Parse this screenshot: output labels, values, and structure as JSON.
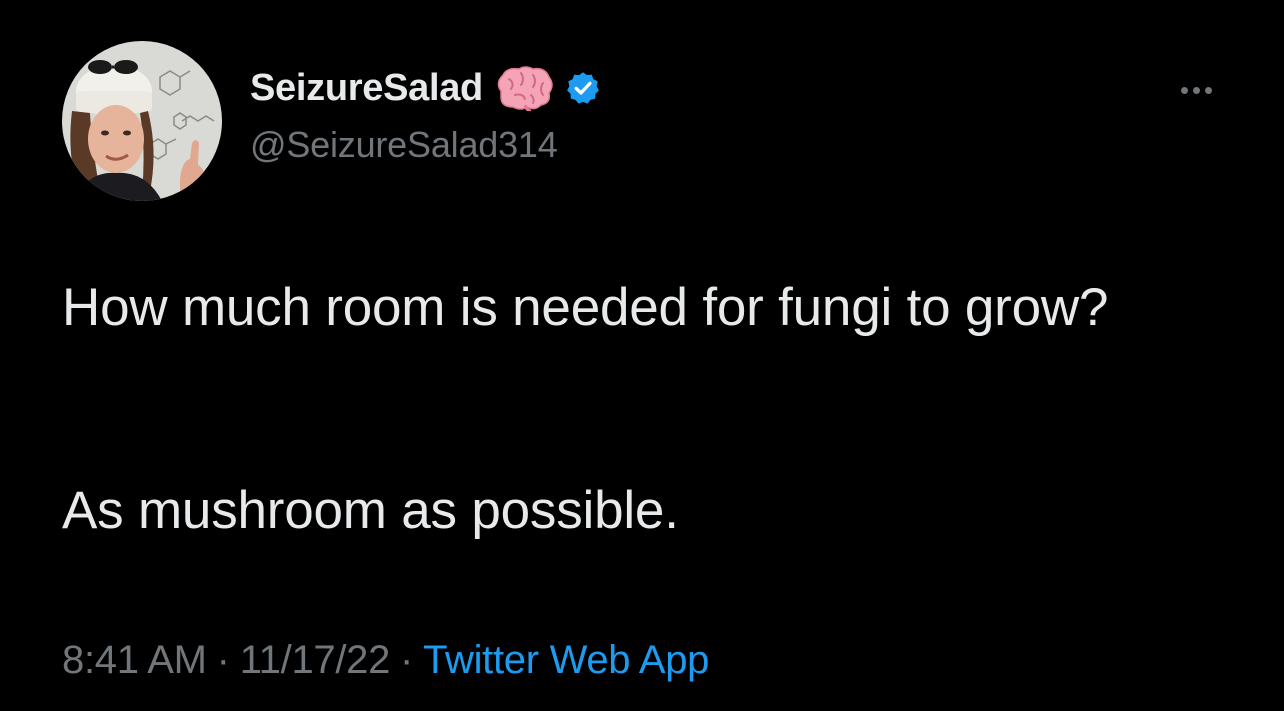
{
  "tweet": {
    "author": {
      "display_name": "SeizureSalad",
      "handle": "@SeizureSalad314",
      "name_emoji": "brain-icon",
      "verified_icon": "verified-badge-icon",
      "avatar": "profile-photo"
    },
    "more_icon": "more-options-icon",
    "text": {
      "paragraph_1": "How much room is needed for fungi to grow?",
      "paragraph_2": "As mushroom as possible."
    },
    "meta": {
      "time": "8:41 AM",
      "separator": "·",
      "date": "11/17/22",
      "source": "Twitter Web App"
    }
  },
  "colors": {
    "background": "#000000",
    "primary_text": "#e7e9ea",
    "secondary_text": "#71767b",
    "accent": "#1d9bf0"
  }
}
